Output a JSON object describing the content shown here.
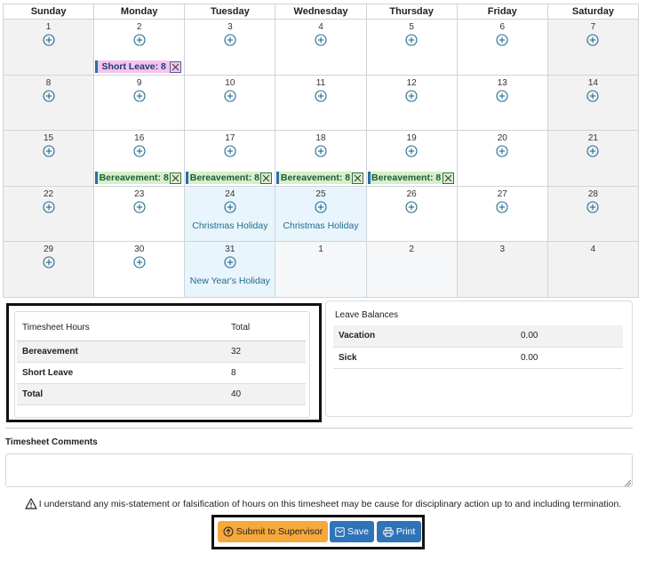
{
  "calendar": {
    "days": [
      "Sunday",
      "Monday",
      "Tuesday",
      "Wednesday",
      "Thursday",
      "Friday",
      "Saturday"
    ],
    "weeks": [
      [
        {
          "num": "1",
          "type": "weekend",
          "add": true
        },
        {
          "num": "2",
          "type": "weekday",
          "add": true,
          "leave": {
            "kind": "short",
            "text": "Short Leave: 8"
          }
        },
        {
          "num": "3",
          "type": "weekday",
          "add": true
        },
        {
          "num": "4",
          "type": "weekday",
          "add": true
        },
        {
          "num": "5",
          "type": "weekday",
          "add": true
        },
        {
          "num": "6",
          "type": "weekday",
          "add": true
        },
        {
          "num": "7",
          "type": "weekend",
          "add": true
        }
      ],
      [
        {
          "num": "8",
          "type": "weekend",
          "add": true
        },
        {
          "num": "9",
          "type": "weekday",
          "add": true
        },
        {
          "num": "10",
          "type": "weekday",
          "add": true
        },
        {
          "num": "11",
          "type": "weekday",
          "add": true
        },
        {
          "num": "12",
          "type": "weekday",
          "add": true
        },
        {
          "num": "13",
          "type": "weekday",
          "add": true
        },
        {
          "num": "14",
          "type": "weekend",
          "add": true
        }
      ],
      [
        {
          "num": "15",
          "type": "weekend",
          "add": true
        },
        {
          "num": "16",
          "type": "weekday",
          "add": true,
          "leave": {
            "kind": "bereave",
            "text": "Bereavement: 8"
          }
        },
        {
          "num": "17",
          "type": "weekday",
          "add": true,
          "leave": {
            "kind": "bereave",
            "text": "Bereavement: 8"
          }
        },
        {
          "num": "18",
          "type": "weekday",
          "add": true,
          "leave": {
            "kind": "bereave",
            "text": "Bereavement: 8"
          }
        },
        {
          "num": "19",
          "type": "weekday",
          "add": true,
          "leave": {
            "kind": "bereave",
            "text": "Bereavement: 8"
          }
        },
        {
          "num": "20",
          "type": "weekday",
          "add": true
        },
        {
          "num": "21",
          "type": "weekend",
          "add": true
        }
      ],
      [
        {
          "num": "22",
          "type": "weekend",
          "add": true
        },
        {
          "num": "23",
          "type": "weekday",
          "add": true
        },
        {
          "num": "24",
          "type": "holiday",
          "add": true,
          "holiday": "Christmas Holiday"
        },
        {
          "num": "25",
          "type": "holiday",
          "add": true,
          "holiday": "Christmas Holiday"
        },
        {
          "num": "26",
          "type": "weekday",
          "add": true
        },
        {
          "num": "27",
          "type": "weekday",
          "add": true
        },
        {
          "num": "28",
          "type": "weekend",
          "add": true
        }
      ],
      [
        {
          "num": "29",
          "type": "weekend",
          "add": true
        },
        {
          "num": "30",
          "type": "weekday",
          "add": true
        },
        {
          "num": "31",
          "type": "holiday",
          "add": true,
          "holiday": "New Year's Holiday"
        },
        {
          "num": "1",
          "type": "othermonth-weekday",
          "add": false
        },
        {
          "num": "2",
          "type": "othermonth-weekday",
          "add": false
        },
        {
          "num": "3",
          "type": "othermonth",
          "add": false
        },
        {
          "num": "4",
          "type": "othermonth",
          "add": false
        }
      ]
    ]
  },
  "timesheet_hours": {
    "header_label": "Timesheet Hours",
    "header_total": "Total",
    "rows": [
      {
        "label": "Bereavement",
        "value": "32"
      },
      {
        "label": "Short Leave",
        "value": "8"
      },
      {
        "label": "Total",
        "value": "40"
      }
    ]
  },
  "leave_balances": {
    "title": "Leave Balances",
    "rows": [
      {
        "label": "Vacation",
        "value": "0.00"
      },
      {
        "label": "Sick",
        "value": "0.00"
      }
    ]
  },
  "comments": {
    "label": "Timesheet Comments",
    "value": ""
  },
  "warning_text": "I understand any mis-statement or falsification of hours on this timesheet may be cause for disciplinary action up to and including termination.",
  "buttons": {
    "submit": "Submit to Supervisor",
    "save": "Save",
    "print": "Print"
  },
  "colors": {
    "accent": "#2f74b8",
    "submit": "#f5a93c",
    "add_icon": "#1f6b8f",
    "short_leave_bg": "#f4c4ec",
    "bereavement_bg": "#d6f0c8",
    "holiday_bg": "#e8f5fc"
  }
}
